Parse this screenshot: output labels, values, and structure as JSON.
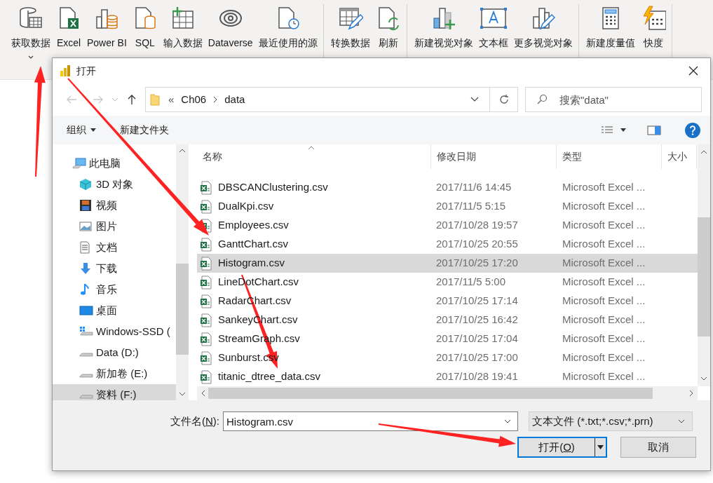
{
  "ribbon": {
    "groups": [
      {
        "items": [
          {
            "label": "获取数据",
            "menu": true
          },
          {
            "label": "Excel",
            "menu": false
          },
          {
            "label": "Power BI",
            "menu": false
          },
          {
            "label": "SQL",
            "menu": false
          },
          {
            "label": "输入数据",
            "menu": false
          },
          {
            "label": "Dataverse",
            "menu": false
          },
          {
            "label": "最近使用的源",
            "menu": false
          }
        ]
      },
      {
        "items": [
          {
            "label": "转换数据",
            "menu": false
          },
          {
            "label": "刷新",
            "menu": false
          }
        ]
      },
      {
        "items": [
          {
            "label": "新建视觉对象",
            "menu": false
          },
          {
            "label": "文本框",
            "menu": false
          },
          {
            "label": "更多视觉对象",
            "menu": false
          }
        ]
      },
      {
        "items": [
          {
            "label": "新建度量值",
            "menu": false
          },
          {
            "label": "快度",
            "menu": false
          }
        ]
      }
    ]
  },
  "dialog": {
    "title": "打开",
    "nav": {
      "back_disabled": true,
      "forward_disabled": true,
      "path_prefix": "«",
      "path": [
        "Ch06",
        "data"
      ],
      "search": {
        "placeholder": "搜索\"data\""
      }
    },
    "toolbar": {
      "organize": "组织",
      "new_folder": "新建文件夹"
    },
    "tree": [
      {
        "label": "此电脑",
        "kind": "computer",
        "selected": false,
        "children": [
          {
            "label": "3D 对象",
            "kind": "cube",
            "selected": false
          },
          {
            "label": "视频",
            "kind": "video",
            "selected": false
          },
          {
            "label": "图片",
            "kind": "pictures",
            "selected": false
          },
          {
            "label": "文档",
            "kind": "documents",
            "selected": false
          },
          {
            "label": "下载",
            "kind": "downloads",
            "selected": false
          },
          {
            "label": "音乐",
            "kind": "music",
            "selected": false
          },
          {
            "label": "桌面",
            "kind": "desktop",
            "selected": false
          },
          {
            "label": "Windows-SSD (",
            "kind": "windows-drive",
            "selected": false
          },
          {
            "label": "Data (D:)",
            "kind": "drive",
            "selected": false
          },
          {
            "label": "新加卷 (E:)",
            "kind": "drive",
            "selected": false
          },
          {
            "label": "资料 (F:)",
            "kind": "drive",
            "selected": true
          }
        ]
      }
    ],
    "table": {
      "columns": [
        "名称",
        "修改日期",
        "类型",
        "大小"
      ],
      "rows": [
        {
          "name": "DBSCANClustering.csv",
          "date": "2017/11/6 14:45",
          "type": "Microsoft Excel ...",
          "selected": false
        },
        {
          "name": "DualKpi.csv",
          "date": "2017/11/5 5:15",
          "type": "Microsoft Excel ...",
          "selected": false
        },
        {
          "name": "Employees.csv",
          "date": "2017/10/28 19:57",
          "type": "Microsoft Excel ...",
          "selected": false
        },
        {
          "name": "GanttChart.csv",
          "date": "2017/10/25 20:55",
          "type": "Microsoft Excel ...",
          "selected": false
        },
        {
          "name": "Histogram.csv",
          "date": "2017/10/25 17:20",
          "type": "Microsoft Excel ...",
          "selected": true
        },
        {
          "name": "LineDotChart.csv",
          "date": "2017/11/5 5:00",
          "type": "Microsoft Excel ...",
          "selected": false
        },
        {
          "name": "RadarChart.csv",
          "date": "2017/10/25 17:14",
          "type": "Microsoft Excel ...",
          "selected": false
        },
        {
          "name": "SankeyChart.csv",
          "date": "2017/10/25 16:42",
          "type": "Microsoft Excel ...",
          "selected": false
        },
        {
          "name": "StreamGraph.csv",
          "date": "2017/10/25 17:04",
          "type": "Microsoft Excel ...",
          "selected": false
        },
        {
          "name": "Sunburst.csv",
          "date": "2017/10/25 17:00",
          "type": "Microsoft Excel ...",
          "selected": false
        },
        {
          "name": "titanic_dtree_data.csv",
          "date": "2017/10/28 19:41",
          "type": "Microsoft Excel ...",
          "selected": false
        }
      ]
    },
    "file_name": {
      "label_before": "文件名(",
      "accelerator": "N",
      "label_after": "):",
      "value": "Histogram.csv"
    },
    "file_type": {
      "value": "文本文件 (*.txt;*.csv;*.prn)"
    },
    "buttons": {
      "open": {
        "label_before": "打开(",
        "accelerator": "O",
        "label_after": ")"
      },
      "cancel": {
        "label": "取消"
      }
    }
  }
}
